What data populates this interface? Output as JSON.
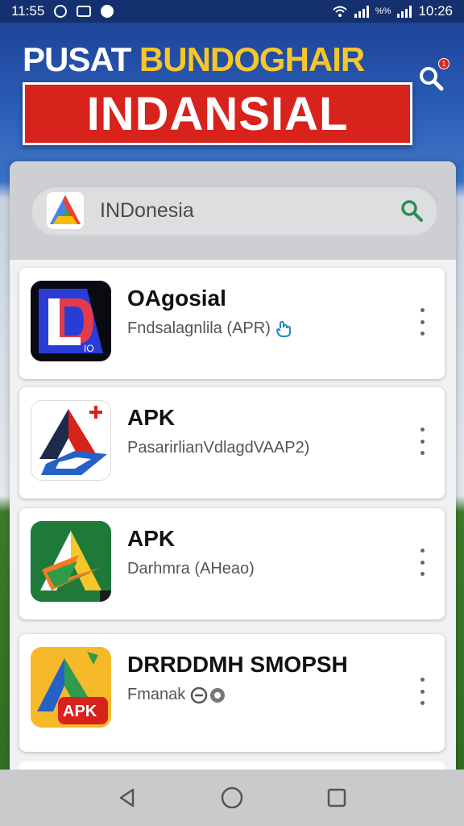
{
  "status_bar": {
    "time_left": "11:55",
    "battery_text": "%%",
    "time_right": "10:26"
  },
  "banner": {
    "title_part1": "PUSAT",
    "title_part2": "BUNDOGHAIR",
    "subtitle": "INDANSIAL",
    "notification_count": "1"
  },
  "search": {
    "value": "INDonesia",
    "placeholder": "INDonesia"
  },
  "apps": [
    {
      "name": "OAgosial",
      "desc": "Fndsalagnlila (APR)",
      "icon": "ld-app-icon",
      "desc_icon": "hand-icon"
    },
    {
      "name": "APK",
      "desc": "PasarirlianVdlagdVAAP2)",
      "icon": "apk-red-icon",
      "desc_icon": ""
    },
    {
      "name": "APK",
      "desc": "Darhmra (AHeao)",
      "icon": "apk-green-icon",
      "desc_icon": ""
    },
    {
      "name": "DRRDDMH SMOPSH",
      "desc": "Fmanak",
      "icon": "apk-yellow-icon",
      "desc_icon": "info-icon",
      "badge": "APK"
    }
  ],
  "colors": {
    "banner_blue": "#1e4498",
    "banner_red": "#d8221c",
    "banner_yellow": "#f6c62a",
    "search_green": "#2e8b57"
  }
}
